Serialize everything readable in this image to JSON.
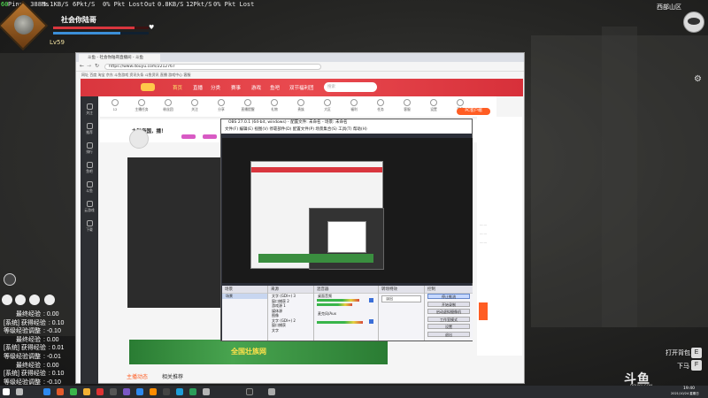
{
  "hud": {
    "stats_line1_left": "Ping: 388Ms",
    "stats_line1_in": "3.1KB/S",
    "stats_line1_pkt_in": "6Pkt/S",
    "stats_line1_lost_in": "0% Pkt Lost",
    "stats_line1_out_label": "Out",
    "stats_line1_out": "0.8KB/S",
    "stats_line1_pkt_out": "12Pkt/S",
    "stats_line1_lost_out": "0% Pkt Lost",
    "fps": "60",
    "player_name": "社会你陆哥",
    "level": "Lv59",
    "hp_fraction": 0.85,
    "mp_fraction": 0.7,
    "zone": "西部山区",
    "hp_color": "#d9363e",
    "mp_color": "#3b8fd8"
  },
  "xp_log": [
    {
      "label": "最终经验",
      "value": ": 0.00"
    },
    {
      "label": "[系统] 获得经验",
      "value": ": 0.10"
    },
    {
      "label": "等级经验调整",
      "value": ": -0.10"
    },
    {
      "label": "最终经验",
      "value": ": 0.00"
    },
    {
      "label": "[系统] 获得经验",
      "value": ": 0.01"
    },
    {
      "label": "等级经验调整",
      "value": ": -0.01"
    },
    {
      "label": "最终经验",
      "value": ": 0.00"
    },
    {
      "label": "[系统] 获得经验",
      "value": ": 0.10"
    },
    {
      "label": "等级经验调整",
      "value": ": -0.10"
    }
  ],
  "game_buttons": {
    "open_backpack": "打开背包",
    "open_backpack_key": "E",
    "next": "下马",
    "next_key": "F"
  },
  "browser": {
    "tab_title": "斗鱼 - 社会你陆哥直播间 - 斗鱼",
    "url": "https://www.douyu.com/2212767",
    "bookmarks": "网址   百度   淘宝   京东   斗鱼游戏   资讯头条   斗鱼资讯   直播   游戏中心   客服",
    "nav_home": "首页",
    "nav_items": [
      "直播",
      "分类",
      "赛事",
      "游戏",
      "鱼吧",
      "双节福利团"
    ],
    "search_placeholder": "搜索",
    "pc_button": "PC客户端",
    "streamer_name": "大陆帝国，播！",
    "bottom_tab_1": "主播动态",
    "bottom_tab_2": "相关推荐",
    "banner_text": "全国壮族网"
  },
  "sidebar": {
    "items": [
      "关注",
      "推荐",
      "排行",
      "鱼吧",
      "斗鱼",
      "云游戏",
      "下载"
    ]
  },
  "toolstrip": {
    "items": [
      "12",
      "主播任务",
      "粉丝团",
      "关注",
      "分享",
      "直播提醒",
      "礼物",
      "贵族",
      "大区",
      "福利",
      "任务",
      "客服",
      "设置",
      "更多"
    ]
  },
  "obs": {
    "title": "OBS 27.0.1 (64-bit, windows) - 配置文件: 未命名 - 场景: 未命名",
    "menu": "文件(F)   编辑(E)   视图(V)   停靠部件(D)   配置文件(P)   场景集合(S)   工具(T)   帮助(H)",
    "dock_scenes": "场景",
    "dock_sources": "来源",
    "dock_mixer": "混音器",
    "dock_transitions": "转场特效",
    "dock_controls": "控制",
    "scene_item": "场景",
    "sources": [
      "文字 (GDI+) 3",
      "窗口捕获 2",
      "游戏源 1",
      "媒体源",
      "图像",
      "文字 (GDI+) 2",
      "窗口捕获",
      "文字"
    ],
    "mixer_items": [
      "桌面音频",
      "麦克风/Aux"
    ],
    "transition": "淡出",
    "controls": [
      "停止推流",
      "开始录制",
      "启动虚拟摄像机",
      "工作室模式",
      "设置",
      "退出"
    ]
  },
  "taskbar": {
    "time": "19:40",
    "date": "2021/10/24 星期日"
  },
  "watermark": {
    "logo": "斗鱼",
    "sub": "DOUYU.COM"
  }
}
